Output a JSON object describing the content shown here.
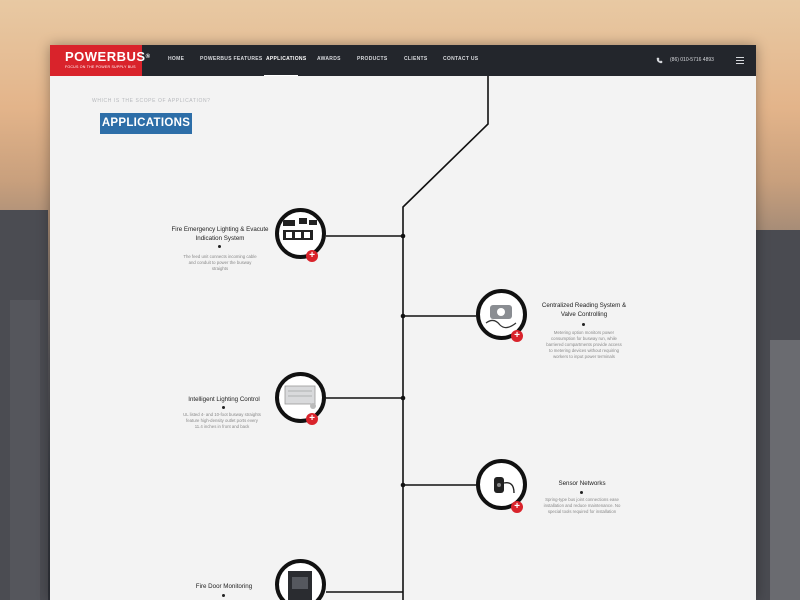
{
  "nav": {
    "brand": "POWERBUS",
    "registered": "®",
    "tagline": "FOCUS ON THE POWER SUPPLY BUS",
    "items": [
      "HOME",
      "POWERBUS FEATURES",
      "APPLICATIONS",
      "AWARDS",
      "PRODUCTS",
      "CLIENTS",
      "CONTACT US"
    ],
    "active_item": "APPLICATIONS",
    "phone": "(86) 010-5716 4893"
  },
  "section": {
    "question": "WHICH IS THE SCOPE OF APPLICATION?",
    "title": "APPLICATIONS"
  },
  "applications": [
    {
      "title": "Fire Emergency Lighting & Evacute Indication System",
      "desc": "The feed unit connects incoming cable and conduit to power the busway straights"
    },
    {
      "title": "Centralized Reading System & Valve Controlling",
      "desc": "Metering option monitors power consumption for busway run, while barriered compartments provide access to metering devices without requiring workers to input power terminals"
    },
    {
      "title": "Intelligent Lighting Control",
      "desc": "UL listed 4- and 10-foot busway straights feature high-density outlet ports every 11.4 inches in front and back"
    },
    {
      "title": "Sensor Networks",
      "desc": "Spring-type bus joint connections ease installation and reduce maintenance. No special tools required for installation"
    },
    {
      "title": "Fire Door Monitoring",
      "desc": ""
    }
  ],
  "plus_symbol": "+",
  "colors": {
    "brand_red": "#d9232b",
    "nav_bg": "#23262c",
    "title_blue": "#2d6ea8"
  }
}
